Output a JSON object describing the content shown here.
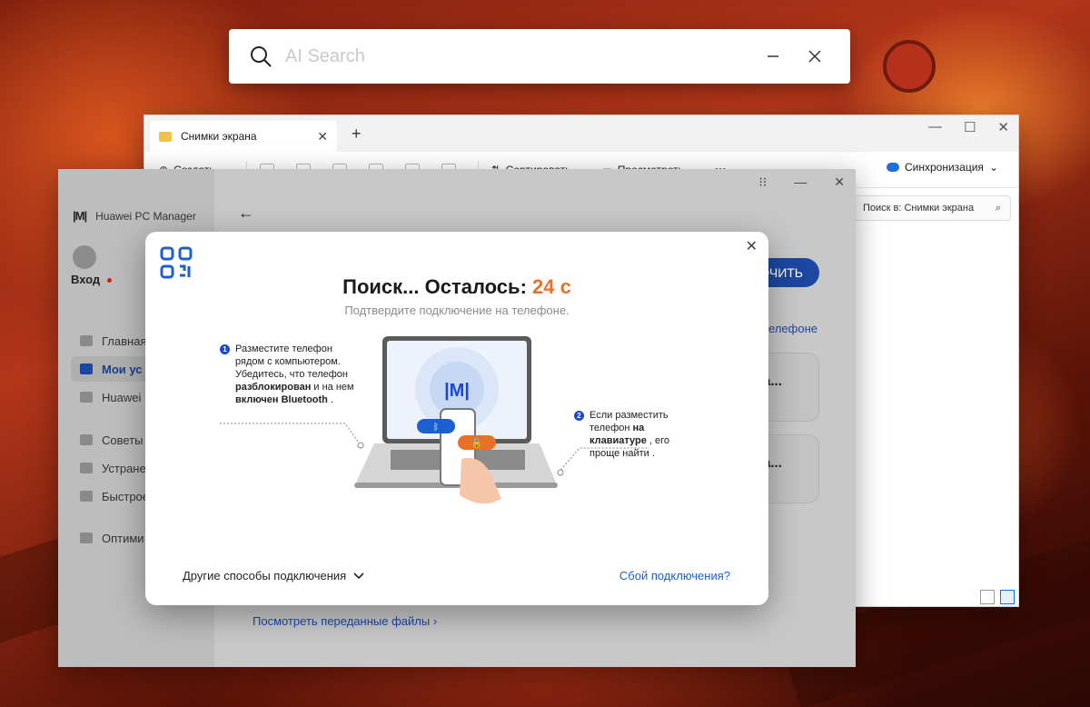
{
  "ai_search": {
    "placeholder": "AI Search"
  },
  "explorer": {
    "tab_title": "Снимки экрана",
    "toolbar": {
      "create": "Создать",
      "sort": "Сортировать",
      "view": "Просмотреть",
      "more": "•••"
    },
    "sync_label": "Синхронизация",
    "search_placeholder": "Поиск в: Снимки экрана"
  },
  "pc_manager": {
    "app_name": "Huawei PC Manager",
    "login": "Вход",
    "nav": [
      {
        "label": "Главная",
        "icon": "home-icon"
      },
      {
        "label": "Мои ус",
        "icon": "devices-icon",
        "active": true
      },
      {
        "label": "Huawei",
        "icon": "wireless-icon"
      },
      {
        "label": "Советы",
        "icon": "info-icon"
      },
      {
        "label": "Устране",
        "icon": "wrench-icon"
      },
      {
        "label": "Быстрое",
        "icon": "shield-icon"
      },
      {
        "label": "Оптими",
        "icon": "optimize-icon"
      }
    ],
    "connect_button": "ОЧИТЬ",
    "phone_link": "телефоне",
    "cards": [
      "ва...",
      "ва..."
    ],
    "files_link": "Посмотреть переданные файлы"
  },
  "dialog": {
    "title_prefix": "Поиск... Осталось:",
    "countdown": "24 с",
    "subtitle": "Подтвердите подключение на телефоне.",
    "step1": {
      "num": "1",
      "text_a": "Разместите телефон рядом с компьютером. Убедитесь, что телефон",
      "bold_a": "разблокирован",
      "text_b": "и на нем",
      "bold_b": "включен Bluetooth",
      "text_c": "."
    },
    "step2": {
      "num": "2",
      "text_a": "Если разместить телефон",
      "bold_a": "на клавиатуре",
      "text_b": ", его проще найти ."
    },
    "other_methods": "Другие способы подключения",
    "connection_failed": "Сбой подключения?"
  }
}
